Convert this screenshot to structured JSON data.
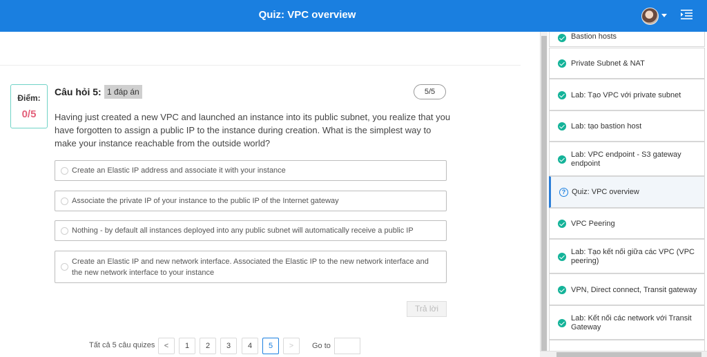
{
  "header": {
    "title": "Quiz: VPC overview",
    "avatar_icon": "avatar",
    "menu_icon": "menu-collapse-icon",
    "bg_color": "#1a7fe0"
  },
  "score": {
    "label": "Điểm:",
    "value": "0/5"
  },
  "question": {
    "heading": "Câu hỏi 5:",
    "tag": "1 đáp án",
    "counter": "5/5",
    "text": "Having just created a new VPC and launched an instance into its public subnet, you realize that you have forgotten to assign a public IP to the instance during creation. What is the simplest way to make your instance reachable from the outside world?",
    "options": [
      "Create an Elastic IP address and associate it with your instance",
      "Associate the private IP of your instance to the public IP of the Internet gateway",
      "Nothing - by default all instances deployed into any public subnet will automatically receive a public IP",
      "Create an Elastic IP and new network interface. Associated the Elastic IP to the new network interface and the new network interface to your instance"
    ],
    "submit_label": "Trả lời"
  },
  "pagination": {
    "total_label": "Tất cả 5 câu quizes",
    "prev": "<",
    "next": ">",
    "pages": [
      "1",
      "2",
      "3",
      "4",
      "5"
    ],
    "current": "5",
    "goto_label": "Go to"
  },
  "sidebar": {
    "items": [
      {
        "label": "Bastion hosts",
        "status": "done"
      },
      {
        "label": "Private Subnet & NAT",
        "status": "done"
      },
      {
        "label": "Lab: Tạo VPC với private subnet",
        "status": "done"
      },
      {
        "label": "Lab: tạo bastion host",
        "status": "done"
      },
      {
        "label": "Lab: VPC endpoint - S3 gateway endpoint",
        "status": "done"
      },
      {
        "label": "Quiz: VPC overview",
        "status": "current"
      },
      {
        "label": "VPC Peering",
        "status": "done"
      },
      {
        "label": "Lab: Tạo kết nối giữa các VPC (VPC peering)",
        "status": "done"
      },
      {
        "label": "VPN, Direct connect, Transit gateway",
        "status": "done"
      },
      {
        "label": "Lab: Kết nối các network với Transit Gateway",
        "status": "done"
      }
    ],
    "check_color": "#14b399",
    "active_color": "#2b7ed8"
  }
}
